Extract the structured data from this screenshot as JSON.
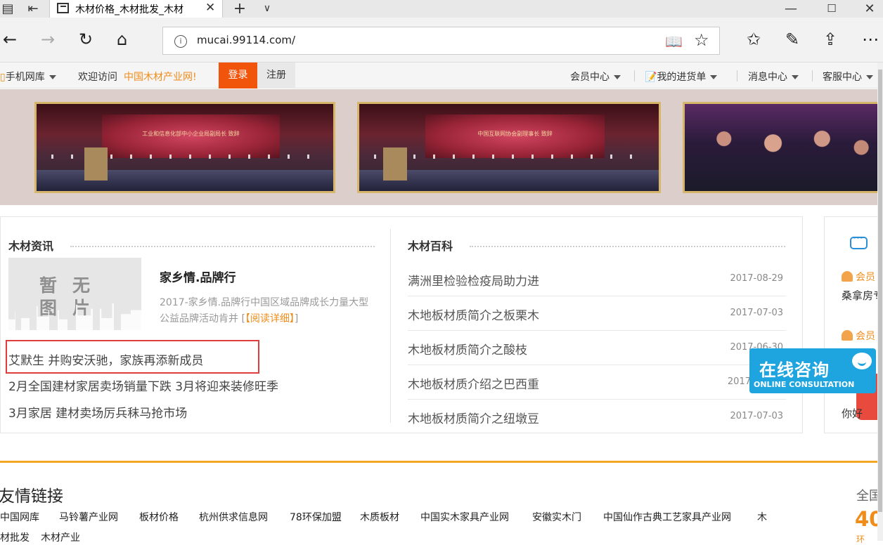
{
  "browser": {
    "tab_title": "木材价格_木材批发_木材",
    "url": "mucai.99114.com/"
  },
  "topbar": {
    "mobile": "手机网库",
    "welcome": "欢迎访问",
    "site": "中国木材产业网!",
    "login": "登录",
    "register": "注册",
    "member_center": "会员中心",
    "my_orders": "我的进货单",
    "messages": "消息中心",
    "service": "客服中心"
  },
  "banner": {
    "slide1_caption": "工业和信息化部中小企业局副局长 致辞",
    "slide2_caption": "中国互联网协会副理事长 致辞"
  },
  "news": {
    "title": "木材资讯",
    "noimage": [
      "暂无",
      "图片"
    ],
    "featured_title": "家乡情.品牌行",
    "featured_desc": "2017-家乡情.品牌行中国区域品牌成长力量大型公益品牌活动肯并 [",
    "read_more": "【阅读详细】",
    "desc_end": "]",
    "items": [
      "艾默生 并购安沃驰，家族再添新成员",
      "2月全国建材家居卖场销量下跌 3月将迎来装修旺季",
      "3月家居 建材卖场厉兵秣马抢市场"
    ]
  },
  "wiki": {
    "title": "木材百科",
    "items": [
      {
        "title": "满洲里检验检疫局助力进",
        "date": "2017-08-29"
      },
      {
        "title": "木地板材质简介之板栗木",
        "date": "2017-07-03"
      },
      {
        "title": "木地板材质简介之酸枝",
        "date": "2017-06-30"
      },
      {
        "title": "木地板材质介绍之巴西重",
        "date": "2017"
      },
      {
        "title": "木地板材质简介之纽墩豆",
        "date": "2017-07-03"
      }
    ]
  },
  "right_panel": {
    "member1": "会员",
    "text1": "桑拿房专",
    "member2": "会员",
    "text2": "你好"
  },
  "consult": {
    "big": "在线咨询",
    "small": "ONLINE CONSULTATION"
  },
  "friend_links": {
    "title": "友情链接",
    "row1": [
      "中国网库",
      "马铃薯产业网",
      "板材价格",
      "杭州供求信息网",
      "78环保加盟",
      "木质板材",
      "中国实木家具产业网",
      "安徽实木门",
      "中国仙作古典工艺家具产业网",
      "木"
    ],
    "row2": [
      "材批发",
      "木材产业"
    ]
  },
  "stats": {
    "label": "全国",
    "number": "40",
    "small": "环"
  }
}
